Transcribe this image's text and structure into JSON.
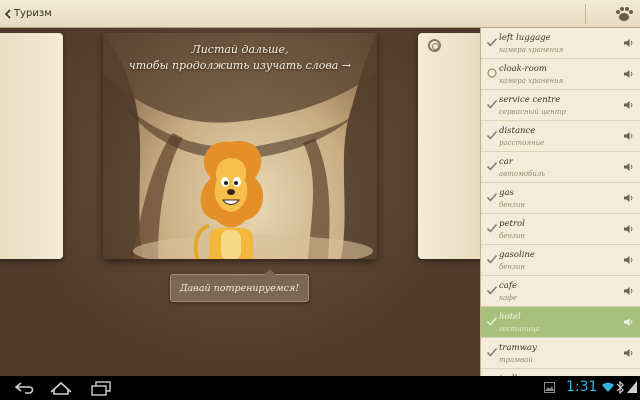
{
  "topbar": {
    "title": "Туризм"
  },
  "card": {
    "line1": "Листай дальше,",
    "line2": "чтобы продолжить изучать слова →"
  },
  "train_button": "Давай потренируемся!",
  "words": [
    {
      "en": "left luggage",
      "ru": "камера хранения",
      "checked": true,
      "active": false
    },
    {
      "en": "cloak-room",
      "ru": "камера хранения",
      "checked": false,
      "active": false
    },
    {
      "en": "service centre",
      "ru": "сервисный центр",
      "checked": true,
      "active": false
    },
    {
      "en": "distance",
      "ru": "расстояние",
      "checked": true,
      "active": false
    },
    {
      "en": "car",
      "ru": "автомобиль",
      "checked": true,
      "active": false
    },
    {
      "en": "gas",
      "ru": "бензин",
      "checked": true,
      "active": false
    },
    {
      "en": "petrol",
      "ru": "бензин",
      "checked": true,
      "active": false
    },
    {
      "en": "gasoline",
      "ru": "бензин",
      "checked": true,
      "active": false
    },
    {
      "en": "cafe",
      "ru": "кафе",
      "checked": true,
      "active": false
    },
    {
      "en": "hotel",
      "ru": "гостиница",
      "checked": true,
      "active": true
    },
    {
      "en": "tramway",
      "ru": "трамвай",
      "checked": true,
      "active": false
    },
    {
      "en": "trolley",
      "ru": "",
      "checked": false,
      "active": false
    }
  ],
  "statusbar": {
    "time": "1:31"
  },
  "colors": {
    "active_row": "#a7c17d",
    "clock": "#33b5e5",
    "check": "#8a8070"
  }
}
